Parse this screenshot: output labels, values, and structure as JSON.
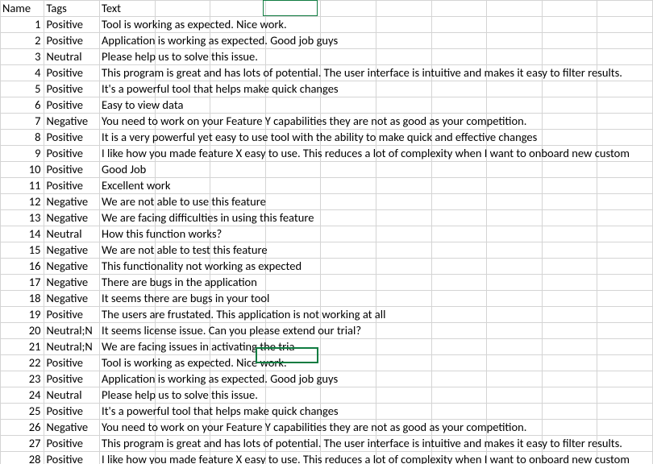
{
  "headers": {
    "name": "Name",
    "tags": "Tags",
    "text": "Text"
  },
  "rows": [
    {
      "name": "1",
      "tags": "Positive",
      "text": "Tool is working as expected. Nice work."
    },
    {
      "name": "2",
      "tags": "Positive",
      "text": "Application is working as expected. Good job guys"
    },
    {
      "name": "3",
      "tags": "Neutral",
      "text": "Please help us to solve this issue."
    },
    {
      "name": "4",
      "tags": "Positive",
      "text": "This program is great and has lots of potential. The user interface is intuitive and makes it easy to filter results."
    },
    {
      "name": "5",
      "tags": "Positive",
      "text": "It's a powerful tool that helps make quick changes"
    },
    {
      "name": "6",
      "tags": "Positive",
      "text": "Easy to view data"
    },
    {
      "name": "7",
      "tags": "Negative",
      "text": "You need to work on your Feature Y capabilities they are not as good as your competition."
    },
    {
      "name": "8",
      "tags": "Positive",
      "text": "It is a very powerful yet easy to use tool with the ability to make quick and effective changes"
    },
    {
      "name": "9",
      "tags": "Positive",
      "text": "I like how you made feature X easy to use. This reduces a lot of complexity when I want to onboard new custom"
    },
    {
      "name": "10",
      "tags": "Positive",
      "text": "Good Job"
    },
    {
      "name": "11",
      "tags": "Positive",
      "text": "Excellent work"
    },
    {
      "name": "12",
      "tags": "Negative",
      "text": "We are not able to use this feature"
    },
    {
      "name": "13",
      "tags": "Negative",
      "text": "We are facing difficulties in using this feature"
    },
    {
      "name": "14",
      "tags": "Neutral",
      "text": "How this function works?"
    },
    {
      "name": "15",
      "tags": "Negative",
      "text": "We are not able to test this feature"
    },
    {
      "name": "16",
      "tags": "Negative",
      "text": "This functionality not working as expected"
    },
    {
      "name": "17",
      "tags": "Negative",
      "text": "There are bugs in the application"
    },
    {
      "name": "18",
      "tags": "Negative",
      "text": "It seems there are bugs in your tool"
    },
    {
      "name": "19",
      "tags": "Positive",
      "text": "The users are frustated. This application is not working at all"
    },
    {
      "name": "20",
      "tags": "Neutral;N",
      "text": "It seems license issue. Can you please extend our trial?"
    },
    {
      "name": "21",
      "tags": "Neutral;N",
      "text": "We are facing issues in activating the tria"
    },
    {
      "name": "22",
      "tags": "Positive",
      "text": "Tool is working as expected. Nice work."
    },
    {
      "name": "23",
      "tags": "Positive",
      "text": "Application is working as expected. Good job guys"
    },
    {
      "name": "24",
      "tags": "Neutral",
      "text": "Please help us to solve this issue."
    },
    {
      "name": "25",
      "tags": "Positive",
      "text": "It's a powerful tool that helps make quick changes"
    },
    {
      "name": "26",
      "tags": "Negative",
      "text": "You need to work on your Feature Y capabilities they are not as good as your competition."
    },
    {
      "name": "27",
      "tags": "Positive",
      "text": "This program is great and has lots of potential. The user interface is intuitive and makes it easy to filter results."
    },
    {
      "name": "28",
      "tags": "Positive",
      "text": "I like how you made feature X easy to use. This reduces a lot of complexity when I want to onboard new custom"
    }
  ]
}
